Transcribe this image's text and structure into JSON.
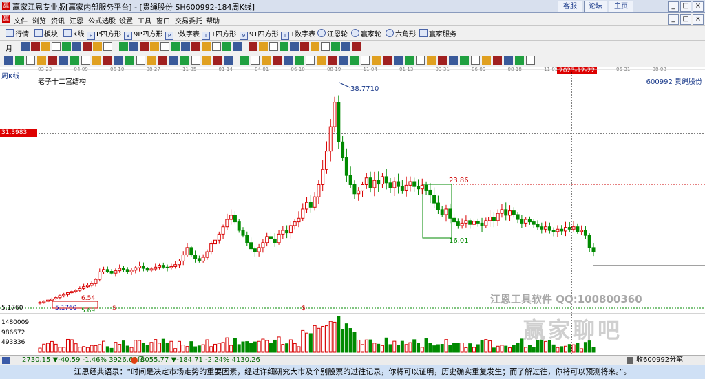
{
  "window": {
    "title": "赢家江恩专业版[赢家内部服务平台] - [贵绳股份  SH600992-184周K线]",
    "buttons": [
      "客服",
      "论坛",
      "主页"
    ],
    "controls": [
      "_",
      "□",
      "×",
      "_",
      "□",
      "×"
    ]
  },
  "menu": [
    "文件",
    "浏览",
    "资讯",
    "江恩",
    "公式选股",
    "设置",
    "工具",
    "窗口",
    "交易委托",
    "帮助"
  ],
  "toolbar1": [
    {
      "label": "行情",
      "icon": "grid-icon"
    },
    {
      "label": "板块",
      "icon": "grid-icon"
    },
    {
      "label": "K线",
      "icon": "candle-icon"
    },
    {
      "label": "P四方形",
      "icon": "p-square-icon"
    },
    {
      "label": "9P四方形",
      "icon": "9p-square-icon"
    },
    {
      "label": "P数字表",
      "icon": "p-table-icon"
    },
    {
      "label": "T四方形",
      "icon": "t-square-icon"
    },
    {
      "label": "9T四方形",
      "icon": "9t-square-icon"
    },
    {
      "label": "T数字表",
      "icon": "t-table-icon"
    },
    {
      "label": "江恩轮",
      "icon": "wheel-icon"
    },
    {
      "label": "赢家轮",
      "icon": "wheel-icon"
    },
    {
      "label": "六角形",
      "icon": "hexagon-icon"
    },
    {
      "label": "赢家服务",
      "icon": "service-icon"
    }
  ],
  "toolbar2_first": "月",
  "chart_header": {
    "period": "周K线",
    "study": "老子十二宫结构",
    "stock": "600992  贵绳股份",
    "cursor_price": "31.3983",
    "cursor_date": "2023-12-22"
  },
  "chart_labels": {
    "high": "38.7710",
    "box_top": "23.86",
    "box_bottom": "16.01",
    "low_left": "5.1760",
    "low_mid": "5.69",
    "lbl_654": "6.54",
    "y_low": "5.1760",
    "vol1": "1480009",
    "vol2": "986672",
    "vol3": "493336",
    "sig": "$"
  },
  "x_dates": [
    "03-23",
    "04-09",
    "06-10",
    "08-27",
    "11-05",
    "01-14",
    "04-01",
    "06-10",
    "08-19",
    "11-04",
    "01-13",
    "03-31",
    "06-09",
    "08-18",
    "11-03",
    "03-22",
    "05-31",
    "08-08"
  ],
  "watermark": {
    "line1": "江恩工具软件  QQ:100800360",
    "line2": "赢家聊吧"
  },
  "status": {
    "sh": "2730.15 ▼-40.59 -1.46% 3926.61亿",
    "sz": "8055.77 ▼-184.71 -2.24% 4130.26",
    "right": "收600992分笔"
  },
  "quote": "江恩经典语录：“时间是决定市场走势的重要因素，经过详细研究大市及个别股票的过往记录，你将可以证明，历史确实重复发生；而了解过往，你将可以预测将来。”。",
  "chart_data": {
    "type": "candlestick",
    "title": "老子十二宫结构",
    "stock": "600992 贵绳股份",
    "period": "周K线",
    "price_range": [
      4.5,
      41
    ],
    "high": 38.771,
    "low": 5.176,
    "levels": [
      31.3983,
      23.86,
      16.01,
      6.54,
      5.69,
      5.176
    ],
    "volume_ticks": [
      1480009,
      986672,
      493336
    ],
    "price_path": [
      5.2,
      5.4,
      5.6,
      5.8,
      6.0,
      6.3,
      6.5,
      6.8,
      7.0,
      7.2,
      7.5,
      7.8,
      8.0,
      8.3,
      9.0,
      10.2,
      10.6,
      10.3,
      10.0,
      10.4,
      10.8,
      10.6,
      10.2,
      10.5,
      10.9,
      11.2,
      10.8,
      10.5,
      10.7,
      11.0,
      11.3,
      11.0,
      10.9,
      11.1,
      11.4,
      12.0,
      13.0,
      14.2,
      13.0,
      12.4,
      12.0,
      12.6,
      13.5,
      14.8,
      15.4,
      16.4,
      17.6,
      18.8,
      19.5,
      18.4,
      17.0,
      16.2,
      15.0,
      14.0,
      13.5,
      14.2,
      15.0,
      16.0,
      15.6,
      15.0,
      16.4,
      17.0,
      16.6,
      17.8,
      18.4,
      19.0,
      20.5,
      21.6,
      20.8,
      22.5,
      24.5,
      27.0,
      30.0,
      34.0,
      38.0,
      31.5,
      29.0,
      26.0,
      24.5,
      23.0,
      23.5,
      24.5,
      25.6,
      24.0,
      25.2,
      24.6,
      25.8,
      24.8,
      24.0,
      25.0,
      24.2,
      23.6,
      24.4,
      25.0,
      24.2,
      23.8,
      24.4,
      23.6,
      22.8,
      21.5,
      20.4,
      19.6,
      20.5,
      19.0,
      18.4,
      17.8,
      18.2,
      18.6,
      18.0,
      18.5,
      18.2,
      17.8,
      18.6,
      19.2,
      18.6,
      19.8,
      20.4,
      19.5,
      20.2,
      19.6,
      18.8,
      18.2,
      18.8,
      18.4,
      18.0,
      17.6,
      17.2,
      17.6,
      17.0,
      16.8,
      17.2,
      16.9,
      17.5,
      17.2,
      17.6,
      16.8,
      17.0,
      16.2,
      14.2,
      13.5
    ]
  }
}
